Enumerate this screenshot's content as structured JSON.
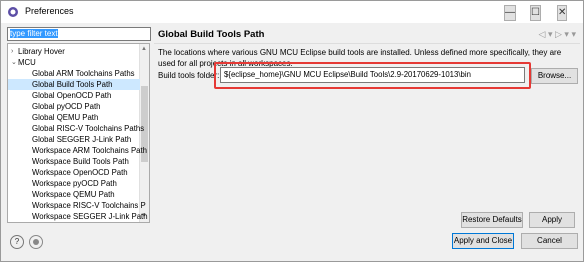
{
  "window": {
    "title": "Preferences"
  },
  "filter": {
    "text": "type filter text"
  },
  "tree": [
    {
      "label": "Library Hover",
      "indent": 1,
      "arrow": "right"
    },
    {
      "label": "MCU",
      "indent": 1,
      "arrow": "down"
    },
    {
      "label": "Global ARM Toolchains Paths",
      "indent": 2
    },
    {
      "label": "Global Build Tools Path",
      "indent": 2,
      "selected": true
    },
    {
      "label": "Global OpenOCD Path",
      "indent": 2
    },
    {
      "label": "Global pyOCD Path",
      "indent": 2
    },
    {
      "label": "Global QEMU Path",
      "indent": 2
    },
    {
      "label": "Global RISC-V Toolchains Paths",
      "indent": 2
    },
    {
      "label": "Global SEGGER J-Link Path",
      "indent": 2
    },
    {
      "label": "Workspace ARM Toolchains Path",
      "indent": 2
    },
    {
      "label": "Workspace Build Tools Path",
      "indent": 2
    },
    {
      "label": "Workspace OpenOCD Path",
      "indent": 2
    },
    {
      "label": "Workspace pyOCD Path",
      "indent": 2
    },
    {
      "label": "Workspace QEMU Path",
      "indent": 2
    },
    {
      "label": "Workspace RISC-V Toolchains P",
      "indent": 2
    },
    {
      "label": "Workspace SEGGER J-Link Path",
      "indent": 2
    }
  ],
  "page": {
    "title": "Global Build Tools Path",
    "description": "The locations where various GNU MCU Eclipse build tools are installed. Unless defined more specifically, they are used for all projects in all workspaces.",
    "build_tools_label": "Build tools folder:",
    "build_tools_value": "${eclipse_home}\\GNU MCU Eclipse\\Build Tools\\2.9-20170629-1013\\bin",
    "browse": "Browse...",
    "restore": "Restore Defaults",
    "apply": "Apply"
  },
  "footer": {
    "apply_close": "Apply and Close",
    "cancel": "Cancel"
  },
  "icons": {
    "back": "◁",
    "forward": "▷",
    "dropdown": "▾",
    "help": "?",
    "minimize": "—",
    "maximize": "☐",
    "close": "✕"
  },
  "colors": {
    "highlight": "#e53935",
    "selected_row": "#cde8ff"
  }
}
